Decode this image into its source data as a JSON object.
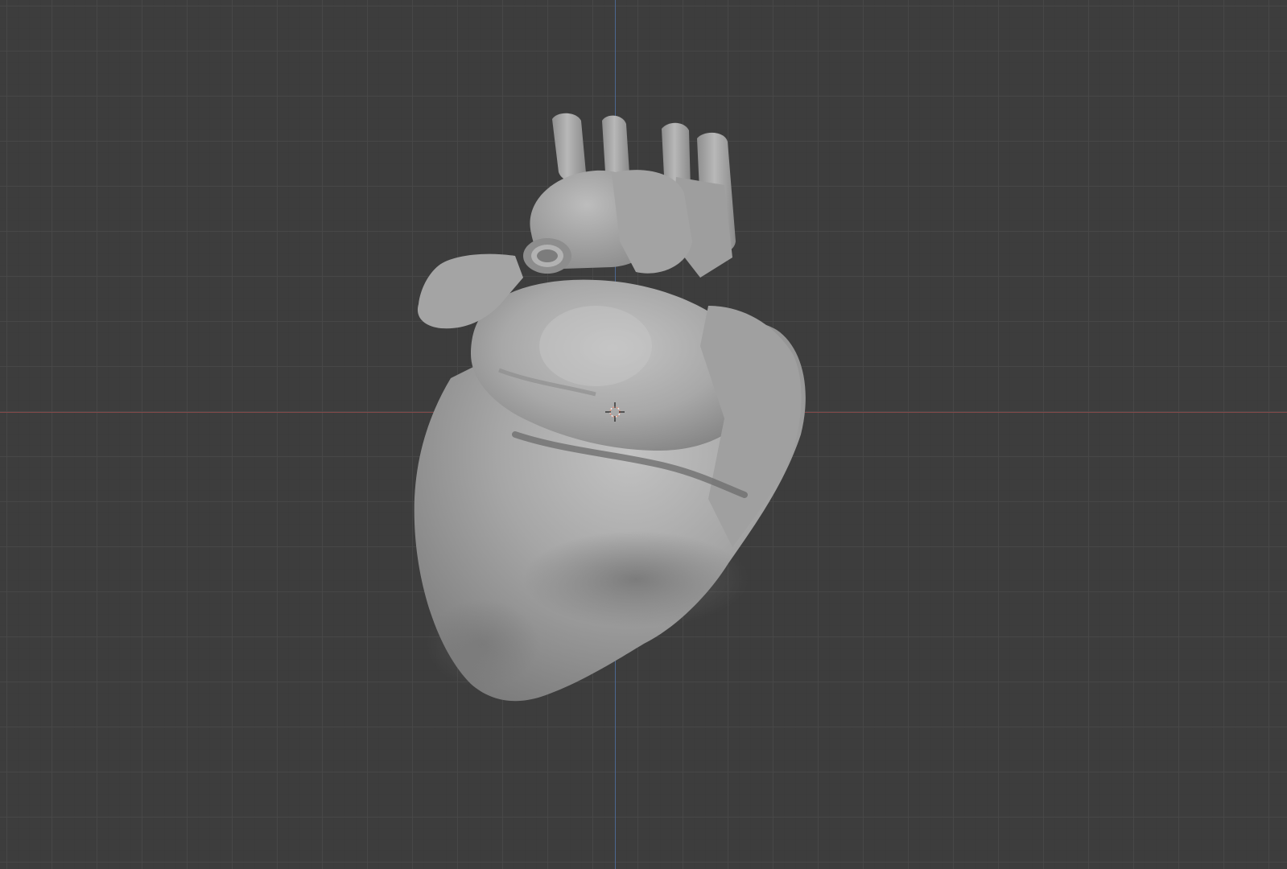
{
  "viewport": {
    "background_color": "#3d3d3d",
    "grid_color": "#484848",
    "x_axis_color": "#8a4a4a",
    "y_axis_color": "#4e6b9a"
  },
  "scene": {
    "object": {
      "name": "heart-mesh",
      "shading": "solid",
      "color": "#9c9c9c"
    },
    "cursor_3d": {
      "icon": "3d-cursor-icon",
      "ring_colors": [
        "#e0907a",
        "#f0f0f0"
      ]
    }
  }
}
